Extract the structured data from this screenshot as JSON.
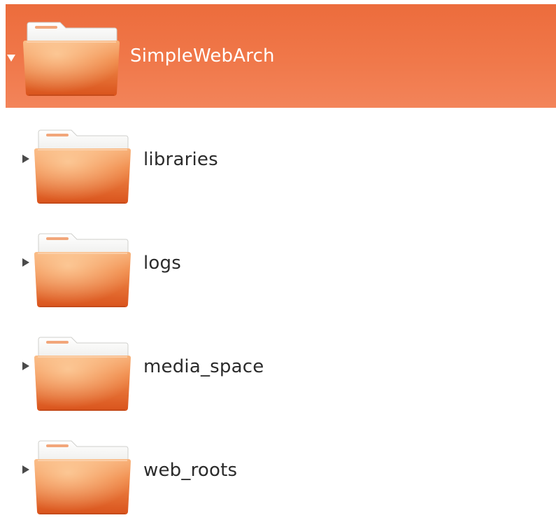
{
  "tree": {
    "root": {
      "label": "SimpleWebArch",
      "expanded": true,
      "icon": "folder-icon"
    },
    "children": [
      {
        "label": "libraries",
        "expanded": false,
        "icon": "folder-icon"
      },
      {
        "label": "logs",
        "expanded": false,
        "icon": "folder-icon"
      },
      {
        "label": "media_space",
        "expanded": false,
        "icon": "folder-icon"
      },
      {
        "label": "web_roots",
        "expanded": false,
        "icon": "folder-icon"
      }
    ]
  },
  "colors": {
    "selection": "#ef7343",
    "folder_body": "#e8652a",
    "folder_body_light": "#f6a56f",
    "folder_paper": "#f7f7f5",
    "text": "#2b2b2b",
    "selected_text": "#ffffff"
  }
}
